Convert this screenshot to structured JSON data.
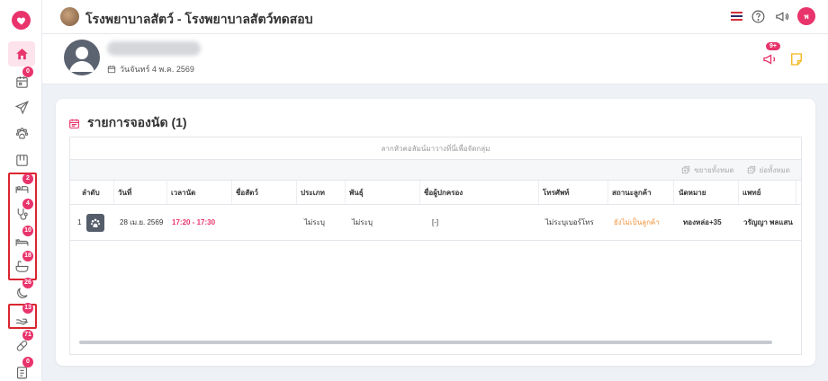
{
  "app": {
    "title": "โรงพยาบาลสัตว์ - โรงพยาบาลสัตว์ทดสอบ",
    "user_initial": "พ",
    "brand_color": "#e8336b"
  },
  "sidebar": {
    "items": [
      {
        "icon": "home-icon",
        "badge": ""
      },
      {
        "icon": "calendar-icon",
        "badge": "0"
      },
      {
        "icon": "send-icon",
        "badge": ""
      },
      {
        "icon": "paw-icon",
        "badge": ""
      },
      {
        "icon": "window-icon",
        "badge": ""
      },
      {
        "icon": "hospital-bed-icon",
        "badge": "2"
      },
      {
        "icon": "stethoscope-icon",
        "badge": "4"
      },
      {
        "icon": "ward-bed-icon",
        "badge": "10"
      },
      {
        "icon": "bath-icon",
        "badge": "18"
      },
      {
        "icon": "moon-icon",
        "badge": "26"
      },
      {
        "icon": "hand-icon",
        "badge": "13"
      },
      {
        "icon": "pill-icon",
        "badge": "71"
      },
      {
        "icon": "document-icon",
        "badge": "0"
      }
    ]
  },
  "profile": {
    "date": "วันจันทร์ 4 พ.ค. 2569",
    "notification_badge": "9+"
  },
  "appointments": {
    "title": "รายการจองนัด (1)",
    "group_hint": "ลากหัวคอลัมน์มาวางที่นี่เพื่อจัดกลุ่ม",
    "expand_all": "ขยายทั้งหมด",
    "collapse_all": "ย่อทั้งหมด",
    "columns": [
      "ลำดับ",
      "วันที่",
      "เวลานัด",
      "ชื่อสัตว์",
      "ประเภท",
      "พันธุ์",
      "ชื่อผู้ปกครอง",
      "โทรศัพท์",
      "สถานะลูกค้า",
      "นัดหมาย",
      "แพทย์"
    ],
    "rows": [
      {
        "index": "1",
        "date": "28 เม.ย. 2569",
        "time": "17:20 - 17:30",
        "pet_name": "",
        "type": "ไม่ระบุ",
        "breed": "ไม่ระบุ",
        "owner": "[-]",
        "phone": "ไม่ระบุเบอร์โทร",
        "status": "ยังไม่เป็นลูกค้า",
        "appointment": "ทองหล่อ+35",
        "doctor": "วรัญญา พลแสน"
      }
    ]
  }
}
